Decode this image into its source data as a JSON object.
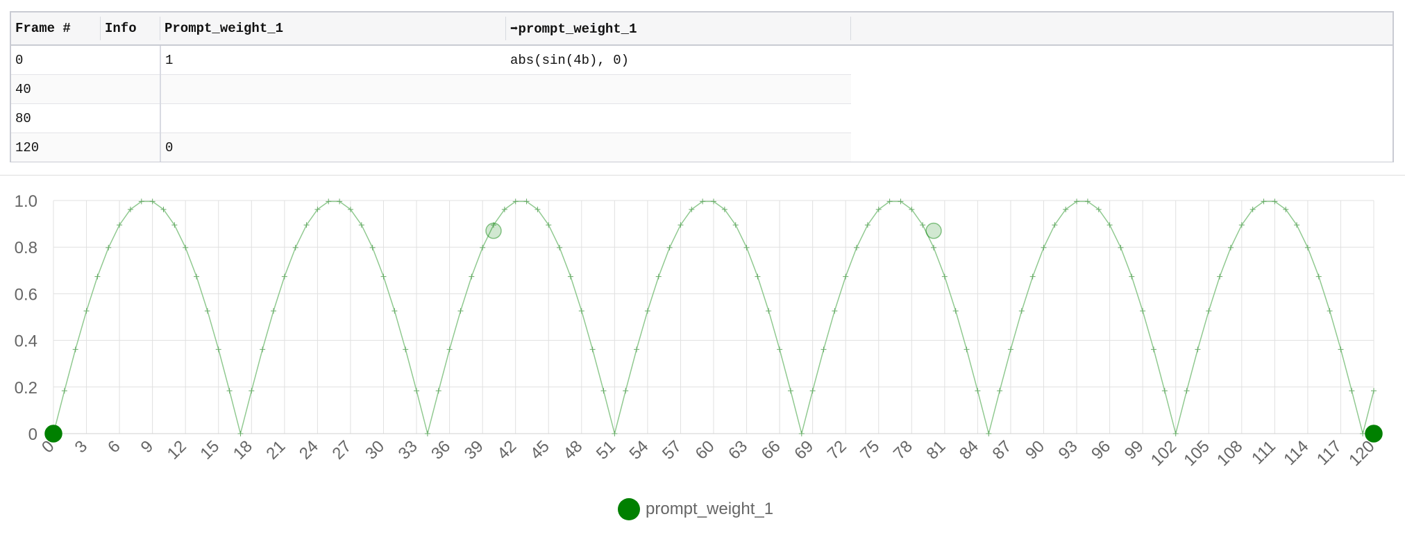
{
  "table": {
    "headers": [
      "Frame #",
      "Info",
      "Prompt_weight_1",
      "➡prompt_weight_1"
    ],
    "rows": [
      [
        "0",
        "",
        "1",
        "abs(sin(4b), 0)"
      ],
      [
        "40",
        "",
        "",
        ""
      ],
      [
        "80",
        "",
        "",
        ""
      ],
      [
        "120",
        "",
        "0",
        ""
      ]
    ]
  },
  "chart_data": {
    "type": "line",
    "xlim": [
      0,
      120
    ],
    "ylim": [
      0,
      1.0
    ],
    "x_ticks": [
      "0",
      "3",
      "6",
      "9",
      "12",
      "15",
      "18",
      "21",
      "24",
      "27",
      "30",
      "33",
      "36",
      "39",
      "42",
      "45",
      "48",
      "51",
      "54",
      "57",
      "60",
      "63",
      "66",
      "69",
      "72",
      "75",
      "78",
      "81",
      "84",
      "87",
      "90",
      "93",
      "96",
      "99",
      "102",
      "105",
      "108",
      "111",
      "114",
      "117",
      "120"
    ],
    "y_ticks": [
      "0",
      "0.2",
      "0.4",
      "0.6",
      "0.8",
      "1.0"
    ],
    "grid": true,
    "series": [
      {
        "name": "prompt_weight_1",
        "color": "#008000",
        "expression": "abs(sin(4b), 0)",
        "keyframes": [
          {
            "x": 0,
            "y": 0
          },
          {
            "x": 40,
            "y": 0.87
          },
          {
            "x": 80,
            "y": 0.87
          },
          {
            "x": 120,
            "y": 0
          }
        ]
      }
    ],
    "legend": "bottom-center"
  }
}
